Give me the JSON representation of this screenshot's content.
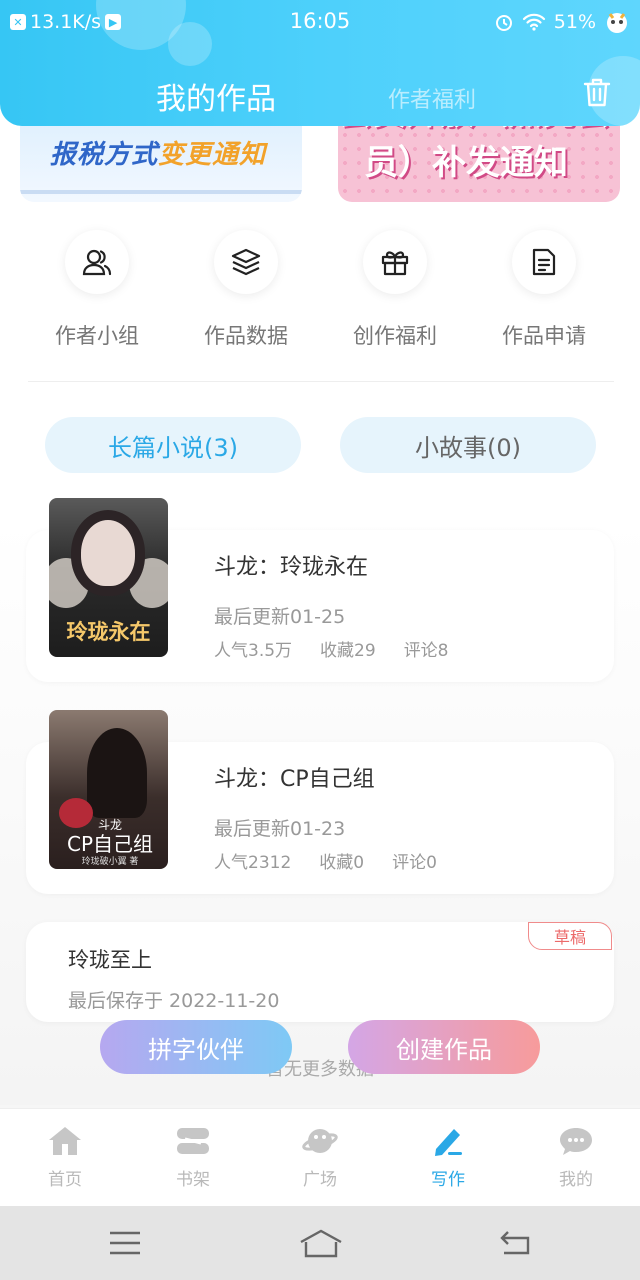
{
  "status_bar": {
    "speed": "13.1K/s",
    "time": "16:05",
    "battery": "51%"
  },
  "header": {
    "title": "我的作品",
    "tab_welfare": "作者福利",
    "delete_icon": "trash-icon"
  },
  "banners": [
    {
      "text_a": "报税方式",
      "text_b": "变更通知"
    },
    {
      "line1": "会员开放（点亮会",
      "line2": "员）补发通知"
    }
  ],
  "quick_actions": [
    {
      "label": "作者小组",
      "icon": "people-icon"
    },
    {
      "label": "作品数据",
      "icon": "layers-icon"
    },
    {
      "label": "创作福利",
      "icon": "gift-icon"
    },
    {
      "label": "作品申请",
      "icon": "document-icon"
    }
  ],
  "segments": {
    "long": "长篇小说(3)",
    "short": "小故事(0)"
  },
  "books": [
    {
      "title": "斗龙：玲珑永在",
      "updated": "最后更新01-25",
      "popularity": "人气3.5万",
      "favorites": "收藏29",
      "comments": "评论8",
      "cover_text": "玲珑永在"
    },
    {
      "title": "斗龙：CP自己组",
      "updated": "最后更新01-23",
      "popularity": "人气2312",
      "favorites": "收藏0",
      "comments": "评论0",
      "cover_text": "CP自己组",
      "cover_sub": "斗龙",
      "cover_author": "玲珑破小翼 著"
    }
  ],
  "draft": {
    "badge": "草稿",
    "title": "玲珑至上",
    "saved": "最后保存于 2022-11-20"
  },
  "no_more": "暂无更多数据",
  "fab": {
    "partner": "拼字伙伴",
    "create": "创建作品"
  },
  "tabbar": [
    {
      "label": "首页",
      "icon": "home-icon",
      "active": false
    },
    {
      "label": "书架",
      "icon": "bookshelf-icon",
      "active": false
    },
    {
      "label": "广场",
      "icon": "planet-icon",
      "active": false
    },
    {
      "label": "写作",
      "icon": "pen-icon",
      "active": true
    },
    {
      "label": "我的",
      "icon": "chat-bubble-icon",
      "active": false
    }
  ],
  "colors": {
    "header": "#36c6f4",
    "accent": "#2aa8e6",
    "draft": "#ec6a6a"
  }
}
